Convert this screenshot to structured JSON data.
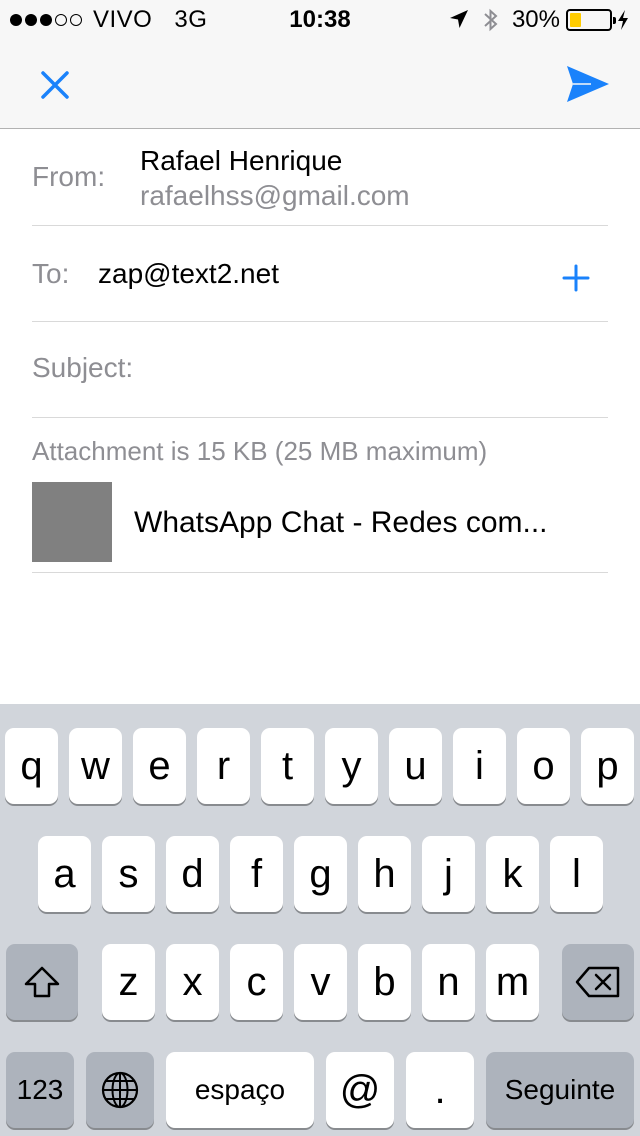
{
  "status_bar": {
    "carrier": "VIVO",
    "network": "3G",
    "time": "10:38",
    "battery_percent": "30%",
    "battery_level": 0.3,
    "signal_bars_filled": 3,
    "signal_bars_total": 5,
    "icons": [
      "location-icon",
      "bluetooth-icon",
      "battery-icon",
      "charging-icon"
    ]
  },
  "nav": {
    "close_icon": "close-icon",
    "send_icon": "send-icon",
    "accent_color": "#1a82fb"
  },
  "compose": {
    "from_label": "From:",
    "from_name": "Rafael Henrique",
    "from_email": "rafaelhss@gmail.com",
    "to_label": "To:",
    "to_value": "zap@text2.net",
    "subject_label": "Subject:",
    "subject_value": "",
    "attachment_info": "Attachment is 15 KB (25 MB maximum)",
    "attachment_name": "WhatsApp Chat - Redes com..."
  },
  "keyboard": {
    "row1": [
      "q",
      "w",
      "e",
      "r",
      "t",
      "y",
      "u",
      "i",
      "o",
      "p"
    ],
    "row2": [
      "a",
      "s",
      "d",
      "f",
      "g",
      "h",
      "j",
      "k",
      "l"
    ],
    "row3": [
      "z",
      "x",
      "c",
      "v",
      "b",
      "n",
      "m"
    ],
    "numbers_label": "123",
    "space_label": "espaço",
    "at_label": "@",
    "dot_label": ".",
    "return_label": "Seguinte"
  }
}
